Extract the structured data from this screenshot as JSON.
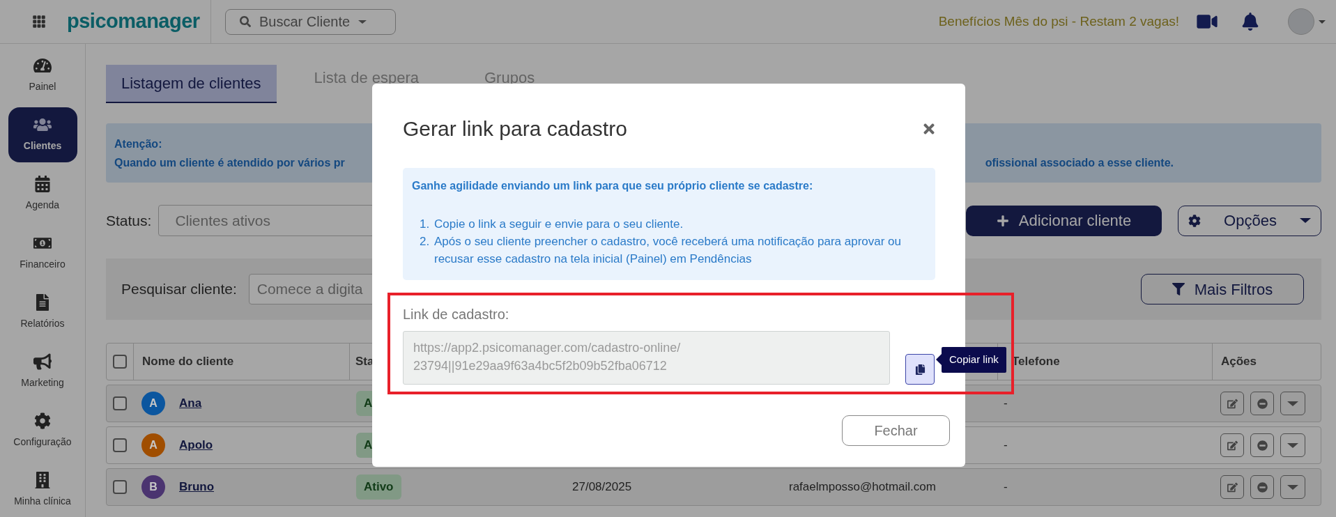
{
  "top_bar": {
    "logo": "psicomanager",
    "search_button": "Buscar Cliente",
    "promo": "Benefícios Mês do psi - Restam 2 vagas!"
  },
  "sidebar": {
    "items": [
      {
        "label": "Painel",
        "selected": false
      },
      {
        "label": "Clientes",
        "selected": true
      },
      {
        "label": "Agenda",
        "selected": false
      },
      {
        "label": "Financeiro",
        "selected": false
      },
      {
        "label": "Relatórios",
        "selected": false
      },
      {
        "label": "Marketing",
        "selected": false
      },
      {
        "label": "Configuração",
        "selected": false
      },
      {
        "label": "Minha clínica",
        "selected": false
      }
    ]
  },
  "tabs": [
    {
      "label": "Listagem de clientes",
      "selected": true
    },
    {
      "label": "Lista de espera",
      "selected": false
    },
    {
      "label": "Grupos",
      "selected": false
    }
  ],
  "notice": {
    "title": "Atenção:",
    "text_left": "Quando um cliente é atendido por vários pr",
    "text_right": "ofissional associado a esse cliente."
  },
  "filters": {
    "status_label": "Status:",
    "status_value": "Clientes ativos",
    "add_button": "Adicionar cliente",
    "options_button": "Opções",
    "search_label": "Pesquisar cliente:",
    "search_placeholder": "Comece a digita",
    "more_filters_button": "Mais Filtros"
  },
  "table": {
    "select_all_checked": false,
    "columns": [
      "Nome do cliente",
      "Sta",
      "Telefone",
      "Ações"
    ],
    "rows": [
      {
        "checked": false,
        "initial": "A",
        "color": "#0b569f",
        "name": "Ana",
        "status": "A",
        "phone": "-"
      },
      {
        "checked": false,
        "initial": "A",
        "color": "#a04e00",
        "name": "Apolo",
        "status": "A",
        "phone": "-"
      },
      {
        "checked": false,
        "initial": "B",
        "color": "#4b3470",
        "name": "Bruno",
        "status": "Ativo",
        "date": "27/08/2025",
        "email": "rafaelmposso@hotmail.com",
        "phone": "-"
      }
    ]
  },
  "modal": {
    "title": "Gerar link para cadastro",
    "intro": "Ganhe agilidade enviando um link para que seu próprio cliente se cadastre:",
    "steps": [
      {
        "number": "1.",
        "text": "Copie o link a seguir e envie para o seu cliente."
      },
      {
        "number": "2.",
        "text": "Após o seu cliente preencher o cadastro, você receberá uma notificação para aprovar ou recusar esse cadastro na tela inicial (Painel) em Pendências"
      }
    ],
    "link_label": "Link de cadastro:",
    "link_value": "https://app2.psicomanager.com/cadastro-online/23794||91e29aa9f63a4bc5f2b09b52fba06712",
    "copy_tooltip": "Copiar link",
    "close_button": "Fechar"
  }
}
